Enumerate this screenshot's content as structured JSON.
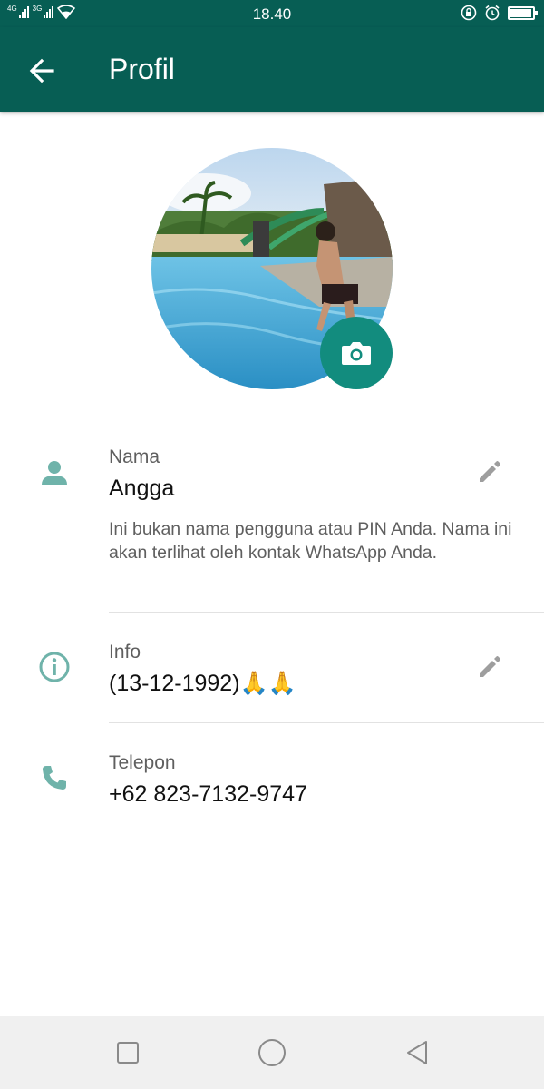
{
  "status_bar": {
    "network_1": "4G",
    "network_2": "3G",
    "time": "18.40",
    "icons": [
      "signal-icon",
      "wifi-icon",
      "rotation-lock-icon",
      "alarm-icon",
      "battery-icon"
    ],
    "battery_level": 0.95
  },
  "app_bar": {
    "title": "Profil",
    "back_icon": "arrow-left-icon"
  },
  "profile": {
    "photo": "profile-photo",
    "camera_icon": "camera-icon"
  },
  "name_section": {
    "label": "Nama",
    "value": "Angga",
    "hint": "Ini bukan nama pengguna atau PIN Anda. Nama ini akan terlihat oleh kontak WhatsApp Anda.",
    "icon": "person-icon",
    "edit_icon": "pencil-icon"
  },
  "info_section": {
    "label": "Info",
    "value": "(13-12-1992)🙏🙏",
    "icon": "info-icon",
    "edit_icon": "pencil-icon"
  },
  "phone_section": {
    "label": "Telepon",
    "value": "+62 823-7132-9747",
    "icon": "phone-icon"
  },
  "nav_bar": {
    "buttons": [
      "recents-square-icon",
      "home-circle-icon",
      "back-triangle-icon"
    ]
  },
  "colors": {
    "primary_dark": "#075e54",
    "accent": "#128c7e",
    "icon_teal": "#6fb3aa",
    "edit_gray": "#9e9e9e"
  }
}
